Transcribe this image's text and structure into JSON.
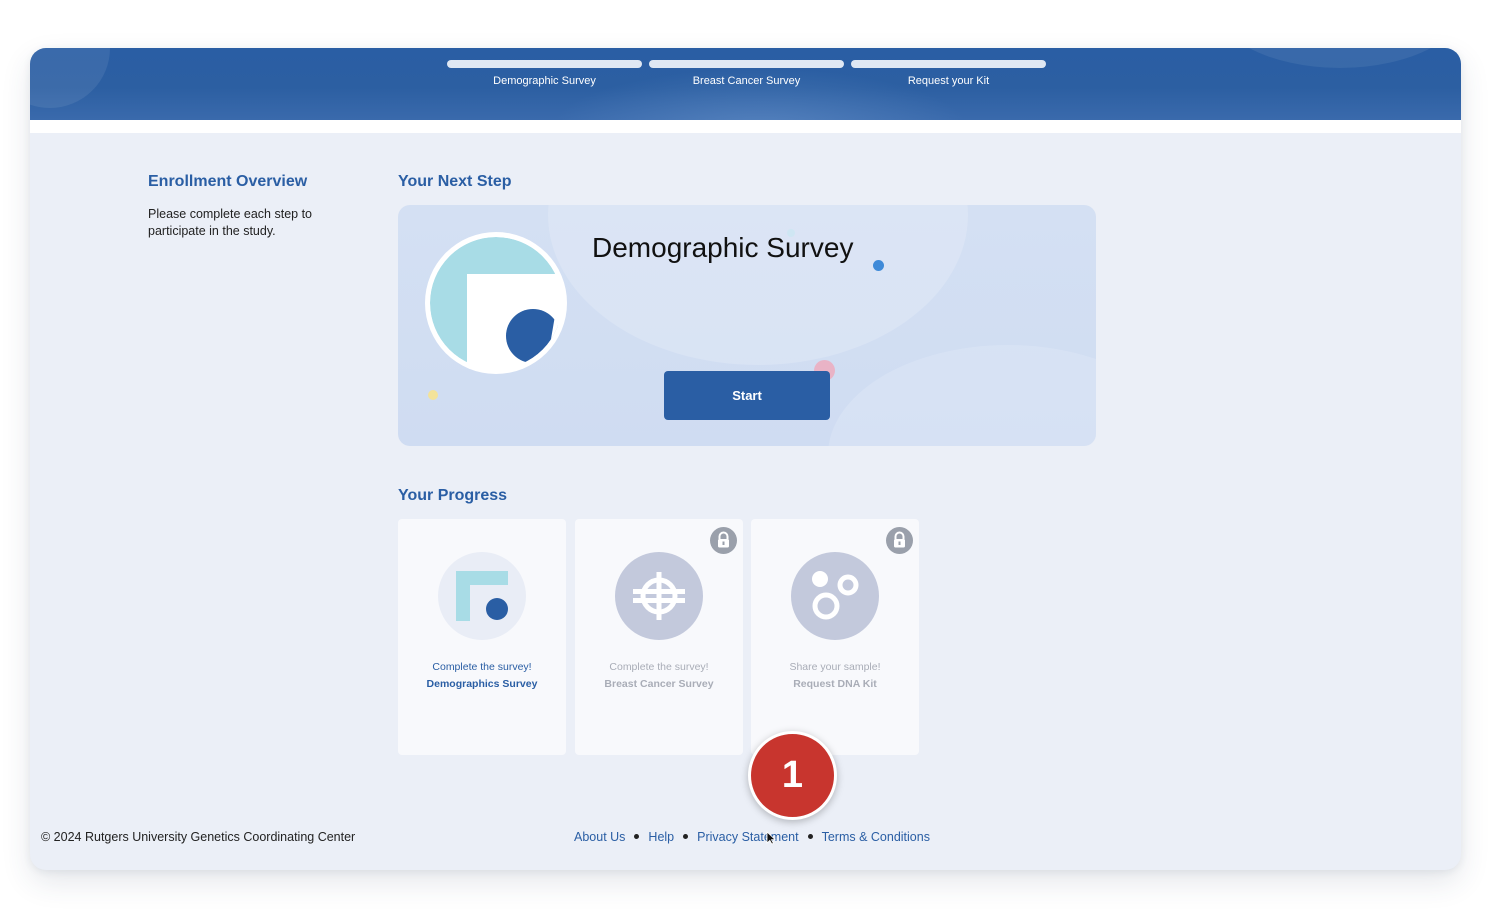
{
  "steps": [
    {
      "label": "Demographic Survey"
    },
    {
      "label": "Breast Cancer Survey"
    },
    {
      "label": "Request your Kit"
    }
  ],
  "overview": {
    "title": "Enrollment Overview",
    "text": "Please complete each step to participate in the study."
  },
  "next_step": {
    "section_title": "Your Next Step",
    "heading": "Demographic Survey",
    "button_label": "Start"
  },
  "progress": {
    "section_title": "Your Progress",
    "cards": [
      {
        "line1": "Complete the survey!",
        "line2": "Demographics Survey",
        "locked": false,
        "icon": "demographics-icon"
      },
      {
        "line1": "Complete the survey!",
        "line2": "Breast Cancer Survey",
        "locked": true,
        "icon": "crosshair-icon"
      },
      {
        "line1": "Share your sample!",
        "line2": "Request DNA Kit",
        "locked": true,
        "icon": "dna-sample-icon"
      }
    ]
  },
  "footer": {
    "copyright": "© 2024 Rutgers University Genetics Coordinating Center",
    "links": [
      "About Us",
      "Help",
      "Privacy Statement",
      "Terms & Conditions"
    ]
  },
  "badge": {
    "number": "1"
  },
  "colors": {
    "brand_blue": "#2a5ea4",
    "accent_teal": "#a8dce6",
    "badge_red": "#c8352e",
    "locked_gray": "#c3c9dc"
  }
}
